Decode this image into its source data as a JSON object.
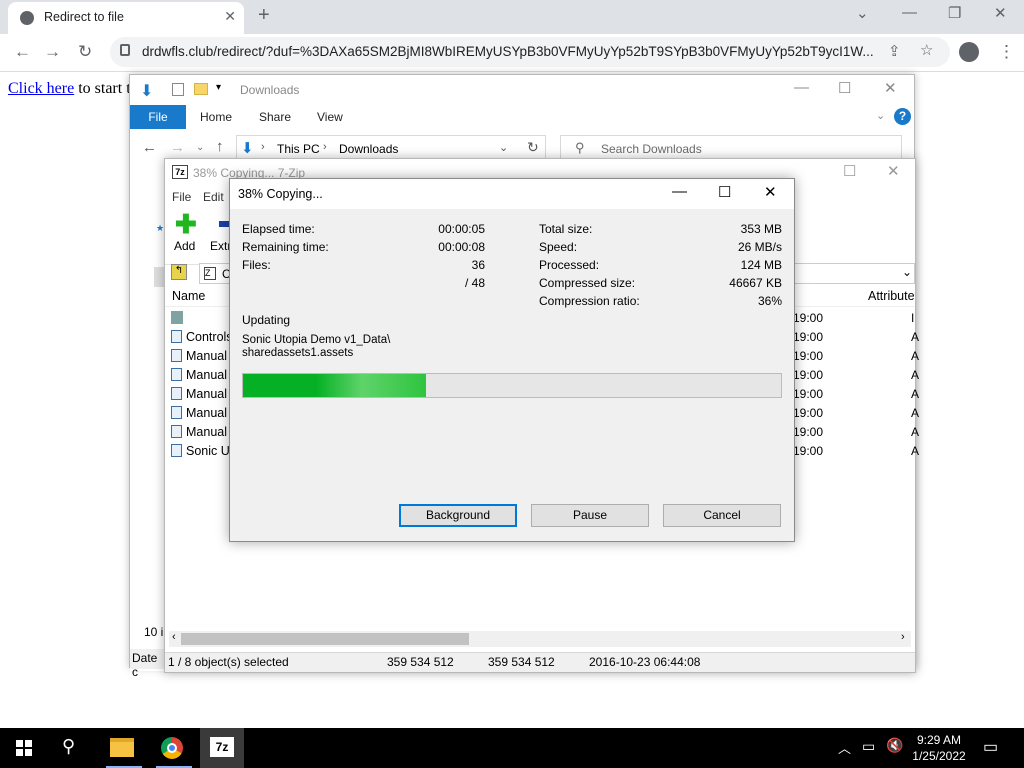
{
  "browser": {
    "tab_title": "Redirect to file",
    "new_tab": "+",
    "url": "drdwfls.club/redirect/?duf=%3DAXa65SM2BjMI8WbIREMyUSYpB3b0VFMyUyYp52bT9SYpB3b0VFMyUyYp52bT9ycI1W..."
  },
  "page": {
    "link_text": "Click here",
    "after_link": " to start t"
  },
  "explorer": {
    "title": "Downloads",
    "ribbon": {
      "file": "File",
      "home": "Home",
      "share": "Share",
      "view": "View"
    },
    "breadcrumb": [
      "This PC",
      "Downloads"
    ],
    "search_placeholder": "Search Downloads",
    "item_count": "10 i",
    "date_col": "Date c"
  },
  "zip": {
    "title": "38% Copying... 7-Zip",
    "menu": {
      "file": "File",
      "edit": "Edit"
    },
    "toolbar": {
      "add": "Add",
      "extract": "Extr"
    },
    "path_fragment": "C",
    "columns": {
      "name": "Name",
      "attributes": "Attribute"
    },
    "rows": [
      {
        "name": "",
        "time": "19:00",
        "attr": "I"
      },
      {
        "name": "Controls",
        "time": "19:00",
        "attr": "A"
      },
      {
        "name": "Manual",
        "time": "19:00",
        "attr": "A"
      },
      {
        "name": "Manual",
        "time": "19:00",
        "attr": "A"
      },
      {
        "name": "Manual",
        "time": "19:00",
        "attr": "A"
      },
      {
        "name": "Manual",
        "time": "19:00",
        "attr": "A"
      },
      {
        "name": "Manual",
        "time": "19:00",
        "attr": "A"
      },
      {
        "name": "Sonic Ut",
        "time": "19:00",
        "attr": "A"
      }
    ],
    "status": {
      "selected": "1 / 8 object(s) selected",
      "size1": "359 534 512",
      "size2": "359 534 512",
      "date": "2016-10-23 06:44:08"
    }
  },
  "dialog": {
    "title": "38% Copying...",
    "left": {
      "elapsed_label": "Elapsed time:",
      "elapsed": "00:00:05",
      "remaining_label": "Remaining time:",
      "remaining": "00:00:08",
      "files_label": "Files:",
      "files": "36",
      "files_total": "/ 48"
    },
    "right": {
      "total_label": "Total size:",
      "total": "353 MB",
      "speed_label": "Speed:",
      "speed": "26 MB/s",
      "processed_label": "Processed:",
      "processed": "124 MB",
      "compressed_label": "Compressed size:",
      "compressed": "46667 KB",
      "ratio_label": "Compression ratio:",
      "ratio": "36%"
    },
    "action": "Updating",
    "file_line1": "Sonic Utopia Demo v1_Data\\",
    "file_line2": "sharedassets1.assets",
    "progress": 0.34,
    "buttons": {
      "background": "Background",
      "pause": "Pause",
      "cancel": "Cancel"
    }
  },
  "taskbar": {
    "time": "9:29 AM",
    "date": "1/25/2022"
  },
  "colors": {
    "progress": "#06b025",
    "accent": "#0078d7",
    "file_tab": "#1979ca"
  }
}
